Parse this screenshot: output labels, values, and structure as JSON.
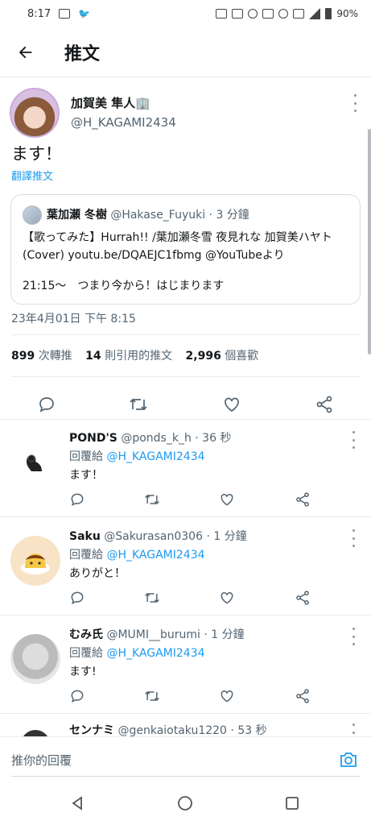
{
  "status_bar": {
    "time": "8:17",
    "battery": "90%"
  },
  "header": {
    "title": "推文",
    "back_icon": "arrow-left-icon"
  },
  "main_tweet": {
    "display_name": "加賀美 隼人🏢",
    "handle": "@H_KAGAMI2434",
    "text": "ます！",
    "translate_label": "翻譯推文",
    "quote": {
      "display_name": "葉加瀬 冬樹",
      "meta": "@Hakase_Fuyuki · 3 分鐘",
      "body": "【歌ってみた】Hurrah!! /葉加瀬冬雪 夜見れな 加賀美ハヤト(Cover) youtu.be/DQAEJC1fbmg @YouTubeより",
      "body2": "21:15〜　つまり今から！はじまります"
    },
    "timestamp": "23年4月01日 下午 8:15",
    "stats": {
      "retweets_count": "899",
      "retweets_label": "次轉推",
      "quotes_count": "14",
      "quotes_label": "則引用的推文",
      "likes_count": "2,996",
      "likes_label": "個喜歡"
    }
  },
  "replies": [
    {
      "name": "POND'S",
      "meta": "@ponds_k_h · 36 秒",
      "reply_prefix": "回覆給",
      "reply_to": "@H_KAGAMI2434",
      "text": "ます！"
    },
    {
      "name": "Saku",
      "meta": "@Sakurasan0306 · 1 分鐘",
      "reply_prefix": "回覆給",
      "reply_to": "@H_KAGAMI2434",
      "text": "ありがと！"
    },
    {
      "name": "むみ氏",
      "meta": "@MUMI__burumi · 1 分鐘",
      "reply_prefix": "回覆給",
      "reply_to": "@H_KAGAMI2434",
      "text": "ます!"
    },
    {
      "name": "センナミ",
      "meta": "@genkaiotaku1220 · 53 秒"
    }
  ],
  "composer": {
    "placeholder": "推你的回覆"
  },
  "colors": {
    "accent": "#1d9bf0",
    "muted": "#536471",
    "divider": "#e6ecf0"
  }
}
